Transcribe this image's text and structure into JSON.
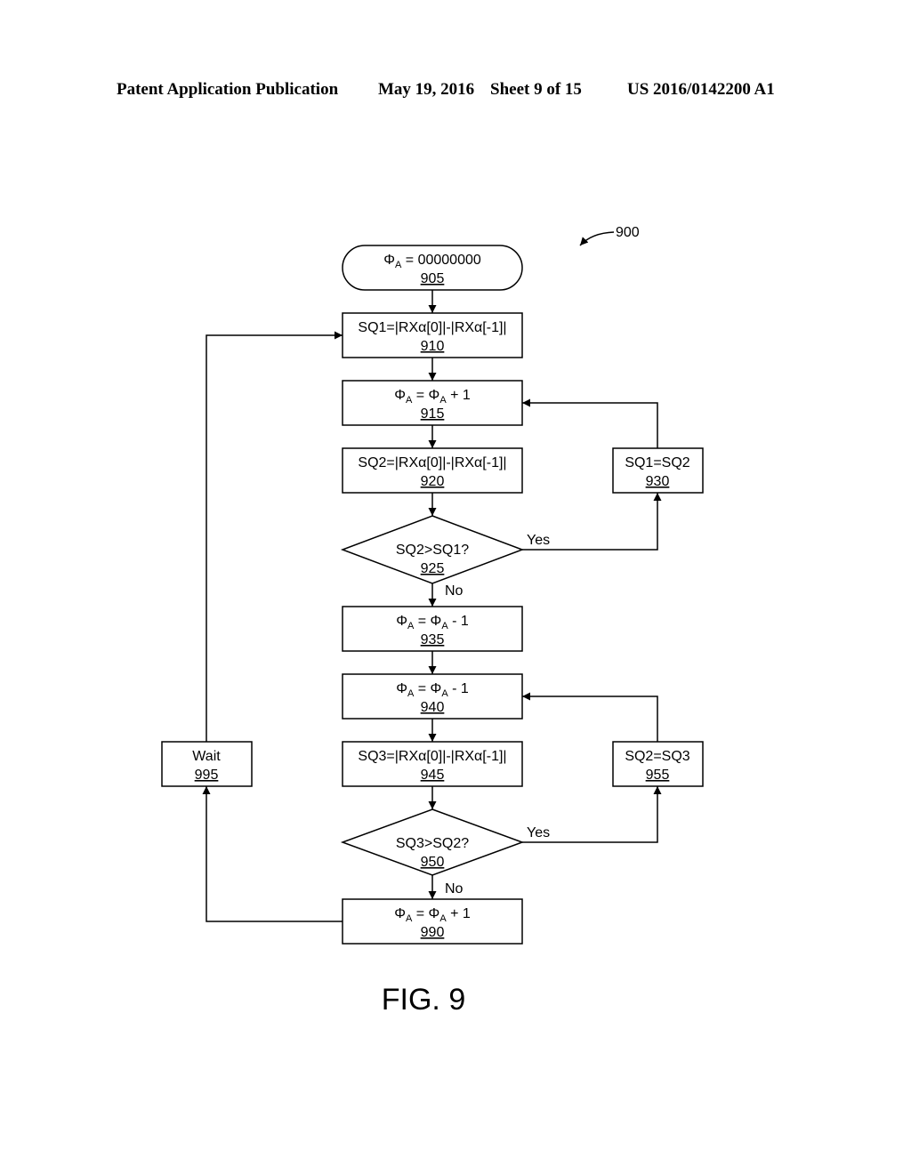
{
  "header": {
    "left": "Patent Application Publication",
    "date": "May 19, 2016",
    "sheet": "Sheet 9 of 15",
    "number": "US 2016/0142200 A1"
  },
  "figure": {
    "ref": "900",
    "caption": "FIG. 9"
  },
  "nodes": {
    "n905": {
      "pre": "Φ",
      "sub": "A",
      "post": " = 00000000",
      "ref": "905"
    },
    "n910": {
      "text": "SQ1=|RXα[0]|-|RXα[-1]|",
      "ref": "910"
    },
    "n915": {
      "a": "Φ",
      "asub": "A",
      "mid": " = Φ",
      "bsub": "A",
      "post": " + 1",
      "ref": "915"
    },
    "n920": {
      "text": "SQ2=|RXα[0]|-|RXα[-1]|",
      "ref": "920"
    },
    "n925": {
      "text": "SQ2>SQ1?",
      "ref": "925"
    },
    "n930": {
      "text": "SQ1=SQ2",
      "ref": "930"
    },
    "n935": {
      "a": "Φ",
      "asub": "A",
      "mid": " = Φ",
      "bsub": "A",
      "post": " - 1",
      "ref": "935"
    },
    "n940": {
      "a": "Φ",
      "asub": "A",
      "mid": " = Φ",
      "bsub": "A",
      "post": " - 1",
      "ref": "940"
    },
    "n945": {
      "text": "SQ3=|RXα[0]|-|RXα[-1]|",
      "ref": "945"
    },
    "n950": {
      "text": "SQ3>SQ2?",
      "ref": "950"
    },
    "n955": {
      "text": "SQ2=SQ3",
      "ref": "955"
    },
    "n990": {
      "a": "Φ",
      "asub": "A",
      "mid": " = Φ",
      "bsub": "A",
      "post": " + 1",
      "ref": "990"
    },
    "n995": {
      "text": "Wait",
      "ref": "995"
    }
  },
  "edge_labels": {
    "yes": "Yes",
    "no": "No"
  }
}
